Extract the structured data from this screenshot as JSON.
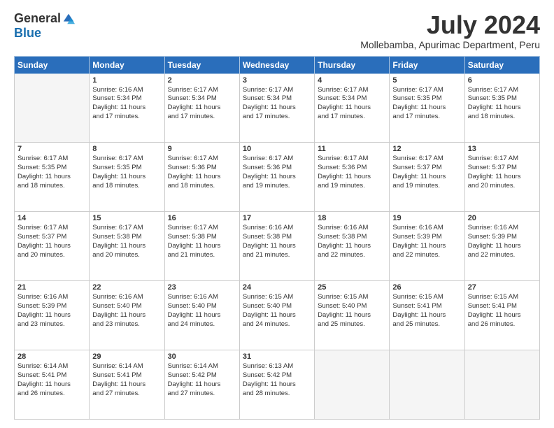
{
  "logo": {
    "general": "General",
    "blue": "Blue"
  },
  "header": {
    "month": "July 2024",
    "location": "Mollebamba, Apurimac Department, Peru"
  },
  "weekdays": [
    "Sunday",
    "Monday",
    "Tuesday",
    "Wednesday",
    "Thursday",
    "Friday",
    "Saturday"
  ],
  "weeks": [
    [
      {
        "day": null,
        "lines": []
      },
      {
        "day": "1",
        "lines": [
          "Sunrise: 6:16 AM",
          "Sunset: 5:34 PM",
          "Daylight: 11 hours",
          "and 17 minutes."
        ]
      },
      {
        "day": "2",
        "lines": [
          "Sunrise: 6:17 AM",
          "Sunset: 5:34 PM",
          "Daylight: 11 hours",
          "and 17 minutes."
        ]
      },
      {
        "day": "3",
        "lines": [
          "Sunrise: 6:17 AM",
          "Sunset: 5:34 PM",
          "Daylight: 11 hours",
          "and 17 minutes."
        ]
      },
      {
        "day": "4",
        "lines": [
          "Sunrise: 6:17 AM",
          "Sunset: 5:34 PM",
          "Daylight: 11 hours",
          "and 17 minutes."
        ]
      },
      {
        "day": "5",
        "lines": [
          "Sunrise: 6:17 AM",
          "Sunset: 5:35 PM",
          "Daylight: 11 hours",
          "and 17 minutes."
        ]
      },
      {
        "day": "6",
        "lines": [
          "Sunrise: 6:17 AM",
          "Sunset: 5:35 PM",
          "Daylight: 11 hours",
          "and 18 minutes."
        ]
      }
    ],
    [
      {
        "day": "7",
        "lines": [
          "Sunrise: 6:17 AM",
          "Sunset: 5:35 PM",
          "Daylight: 11 hours",
          "and 18 minutes."
        ]
      },
      {
        "day": "8",
        "lines": [
          "Sunrise: 6:17 AM",
          "Sunset: 5:35 PM",
          "Daylight: 11 hours",
          "and 18 minutes."
        ]
      },
      {
        "day": "9",
        "lines": [
          "Sunrise: 6:17 AM",
          "Sunset: 5:36 PM",
          "Daylight: 11 hours",
          "and 18 minutes."
        ]
      },
      {
        "day": "10",
        "lines": [
          "Sunrise: 6:17 AM",
          "Sunset: 5:36 PM",
          "Daylight: 11 hours",
          "and 19 minutes."
        ]
      },
      {
        "day": "11",
        "lines": [
          "Sunrise: 6:17 AM",
          "Sunset: 5:36 PM",
          "Daylight: 11 hours",
          "and 19 minutes."
        ]
      },
      {
        "day": "12",
        "lines": [
          "Sunrise: 6:17 AM",
          "Sunset: 5:37 PM",
          "Daylight: 11 hours",
          "and 19 minutes."
        ]
      },
      {
        "day": "13",
        "lines": [
          "Sunrise: 6:17 AM",
          "Sunset: 5:37 PM",
          "Daylight: 11 hours",
          "and 20 minutes."
        ]
      }
    ],
    [
      {
        "day": "14",
        "lines": [
          "Sunrise: 6:17 AM",
          "Sunset: 5:37 PM",
          "Daylight: 11 hours",
          "and 20 minutes."
        ]
      },
      {
        "day": "15",
        "lines": [
          "Sunrise: 6:17 AM",
          "Sunset: 5:38 PM",
          "Daylight: 11 hours",
          "and 20 minutes."
        ]
      },
      {
        "day": "16",
        "lines": [
          "Sunrise: 6:17 AM",
          "Sunset: 5:38 PM",
          "Daylight: 11 hours",
          "and 21 minutes."
        ]
      },
      {
        "day": "17",
        "lines": [
          "Sunrise: 6:16 AM",
          "Sunset: 5:38 PM",
          "Daylight: 11 hours",
          "and 21 minutes."
        ]
      },
      {
        "day": "18",
        "lines": [
          "Sunrise: 6:16 AM",
          "Sunset: 5:38 PM",
          "Daylight: 11 hours",
          "and 22 minutes."
        ]
      },
      {
        "day": "19",
        "lines": [
          "Sunrise: 6:16 AM",
          "Sunset: 5:39 PM",
          "Daylight: 11 hours",
          "and 22 minutes."
        ]
      },
      {
        "day": "20",
        "lines": [
          "Sunrise: 6:16 AM",
          "Sunset: 5:39 PM",
          "Daylight: 11 hours",
          "and 22 minutes."
        ]
      }
    ],
    [
      {
        "day": "21",
        "lines": [
          "Sunrise: 6:16 AM",
          "Sunset: 5:39 PM",
          "Daylight: 11 hours",
          "and 23 minutes."
        ]
      },
      {
        "day": "22",
        "lines": [
          "Sunrise: 6:16 AM",
          "Sunset: 5:40 PM",
          "Daylight: 11 hours",
          "and 23 minutes."
        ]
      },
      {
        "day": "23",
        "lines": [
          "Sunrise: 6:16 AM",
          "Sunset: 5:40 PM",
          "Daylight: 11 hours",
          "and 24 minutes."
        ]
      },
      {
        "day": "24",
        "lines": [
          "Sunrise: 6:15 AM",
          "Sunset: 5:40 PM",
          "Daylight: 11 hours",
          "and 24 minutes."
        ]
      },
      {
        "day": "25",
        "lines": [
          "Sunrise: 6:15 AM",
          "Sunset: 5:40 PM",
          "Daylight: 11 hours",
          "and 25 minutes."
        ]
      },
      {
        "day": "26",
        "lines": [
          "Sunrise: 6:15 AM",
          "Sunset: 5:41 PM",
          "Daylight: 11 hours",
          "and 25 minutes."
        ]
      },
      {
        "day": "27",
        "lines": [
          "Sunrise: 6:15 AM",
          "Sunset: 5:41 PM",
          "Daylight: 11 hours",
          "and 26 minutes."
        ]
      }
    ],
    [
      {
        "day": "28",
        "lines": [
          "Sunrise: 6:14 AM",
          "Sunset: 5:41 PM",
          "Daylight: 11 hours",
          "and 26 minutes."
        ]
      },
      {
        "day": "29",
        "lines": [
          "Sunrise: 6:14 AM",
          "Sunset: 5:41 PM",
          "Daylight: 11 hours",
          "and 27 minutes."
        ]
      },
      {
        "day": "30",
        "lines": [
          "Sunrise: 6:14 AM",
          "Sunset: 5:42 PM",
          "Daylight: 11 hours",
          "and 27 minutes."
        ]
      },
      {
        "day": "31",
        "lines": [
          "Sunrise: 6:13 AM",
          "Sunset: 5:42 PM",
          "Daylight: 11 hours",
          "and 28 minutes."
        ]
      },
      {
        "day": null,
        "lines": []
      },
      {
        "day": null,
        "lines": []
      },
      {
        "day": null,
        "lines": []
      }
    ]
  ]
}
